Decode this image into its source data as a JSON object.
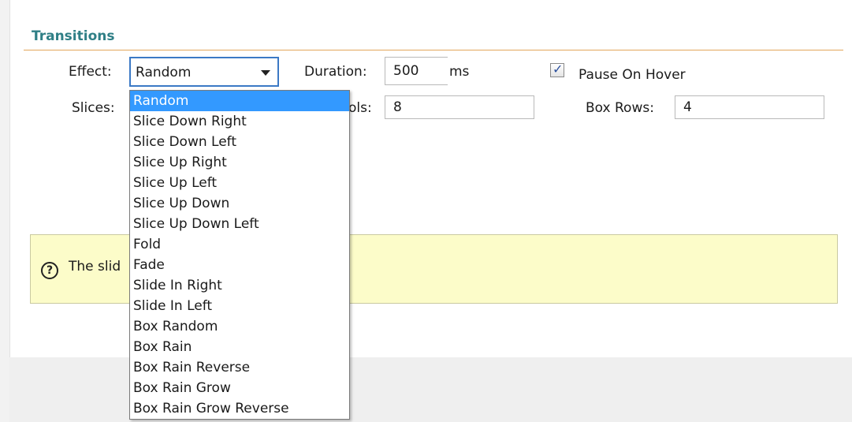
{
  "section": {
    "title": "Transitions"
  },
  "effect": {
    "label": "Effect:",
    "selected": "Random",
    "options": [
      "Random",
      "Slice Down Right",
      "Slice Down Left",
      "Slice Up Right",
      "Slice Up Left",
      "Slice Up Down",
      "Slice Up Down Left",
      "Fold",
      "Fade",
      "Slide In Right",
      "Slide In Left",
      "Box Random",
      "Box Rain",
      "Box Rain Reverse",
      "Box Rain Grow",
      "Box Rain Grow Reverse"
    ]
  },
  "duration": {
    "label": "Duration:",
    "value": "500",
    "unit": "ms"
  },
  "pause_on_hover": {
    "label": "Pause On Hover",
    "checked": true
  },
  "slices": {
    "label": "Slices:"
  },
  "box_cols": {
    "label_partial": "ols:",
    "value": "8"
  },
  "box_rows": {
    "label": "Box Rows:",
    "value": "4"
  },
  "help": {
    "text_partial": "The slid",
    "icon": "question-circle-icon"
  },
  "colors": {
    "section_title": "#2f7f86",
    "rule": "#e3a65a",
    "help_bg": "#fcfcc9",
    "selection": "#3399ff"
  }
}
